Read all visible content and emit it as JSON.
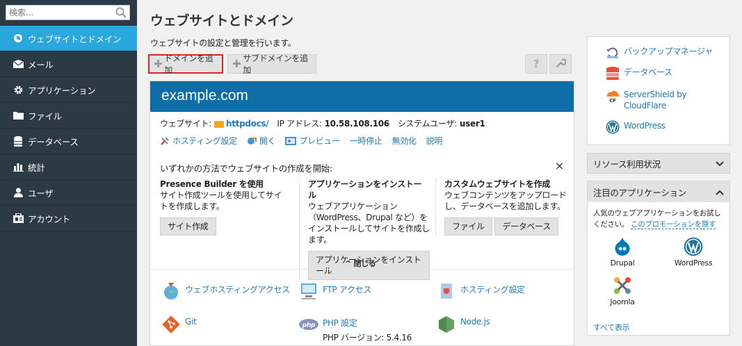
{
  "search": {
    "placeholder": "検索..."
  },
  "nav": [
    {
      "label": "ウェブサイトとドメイン",
      "icon": "globe-icon",
      "active": true
    },
    {
      "label": "メール",
      "icon": "mail-icon"
    },
    {
      "label": "アプリケーション",
      "icon": "gear-icon"
    },
    {
      "label": "ファイル",
      "icon": "folder-icon"
    },
    {
      "label": "データベース",
      "icon": "database-icon"
    },
    {
      "label": "統計",
      "icon": "bar-chart-icon"
    },
    {
      "label": "ユーザ",
      "icon": "user-icon"
    },
    {
      "label": "アカウント",
      "icon": "account-icon"
    }
  ],
  "page": {
    "title": "ウェブサイトとドメイン",
    "subtitle": "ウェブサイトの設定と管理を行います。"
  },
  "toolbar": {
    "add_domain": "ドメインを追加",
    "add_subdomain": "サブドメインを追加",
    "help": "?"
  },
  "domain": {
    "name": "example.com",
    "website_label": "ウェブサイト:",
    "website_value": "httpdocs/",
    "ip_label": "IP アドレス:",
    "ip_value": "10.58.108.106",
    "sysuser_label": "システムユーザ:",
    "sysuser_value": "user1",
    "actions": [
      {
        "label": "ホスティング設定",
        "icon": "tools-icon"
      },
      {
        "label": "開く",
        "icon": "open-icon"
      },
      {
        "label": "プレビュー",
        "icon": "preview-icon"
      },
      {
        "label": "一時停止"
      },
      {
        "label": "無効化"
      },
      {
        "label": "説明"
      }
    ]
  },
  "start": {
    "title": "いずれかの方法でウェブサイトの作成を開始:",
    "close": "×",
    "options": [
      {
        "title": "Presence Builder を使用",
        "desc": "サイト作成ツールを使用してサイトを作成します。",
        "buttons": [
          "サイト作成"
        ]
      },
      {
        "title": "アプリケーションをインストール",
        "desc": "ウェブアプリケーション（WordPress、Drupal など）をインストールしてサイトを作成します。",
        "buttons": [
          "アプリケーションをインストール"
        ]
      },
      {
        "title": "カスタムウェブサイトを作成",
        "desc": "ウェブコンテンツをアップロードし、データベースを追加します。",
        "buttons": [
          "ファイル",
          "データベース"
        ]
      }
    ],
    "collapse": "閉じる"
  },
  "features": [
    {
      "label": "ウェブホスティングアクセス",
      "icon": "hosting-access-icon"
    },
    {
      "label": "FTP アクセス",
      "icon": "ftp-icon"
    },
    {
      "label": "ホスティング設定",
      "icon": "hosting-settings-icon"
    },
    {
      "label": "Git",
      "icon": "git-icon"
    },
    {
      "label": "PHP 設定",
      "icon": "php-icon",
      "sub": "PHP バージョン: 5.4.16"
    },
    {
      "label": "Node.js",
      "icon": "nodejs-icon"
    }
  ],
  "quick_links": [
    {
      "label": "バックアップマネージャ",
      "icon": "backup-icon"
    },
    {
      "label": "データベース",
      "icon": "database-icon"
    },
    {
      "label": "ServerShield by CloudFlare",
      "icon": "cloudflare-icon"
    },
    {
      "label": "WordPress",
      "icon": "wordpress-icon"
    }
  ],
  "resources": {
    "title": "リソース利用状況"
  },
  "apps": {
    "title": "注目のアプリケーション",
    "desc": "人気のウェブアプリケーションをお試しください。",
    "promo_link": "このプロモーションを隠す",
    "items": [
      {
        "label": "Drupal",
        "icon": "drupal-icon"
      },
      {
        "label": "WordPress",
        "icon": "wordpress-icon"
      },
      {
        "label": "Joomla",
        "icon": "joomla-icon"
      }
    ],
    "show_all": "すべて表示"
  },
  "colors": {
    "sidebar": "#2c3a44",
    "active": "#2aa7dd",
    "header": "#0f6ea8",
    "link": "#1e7bb8",
    "highlight": "#e02424"
  }
}
